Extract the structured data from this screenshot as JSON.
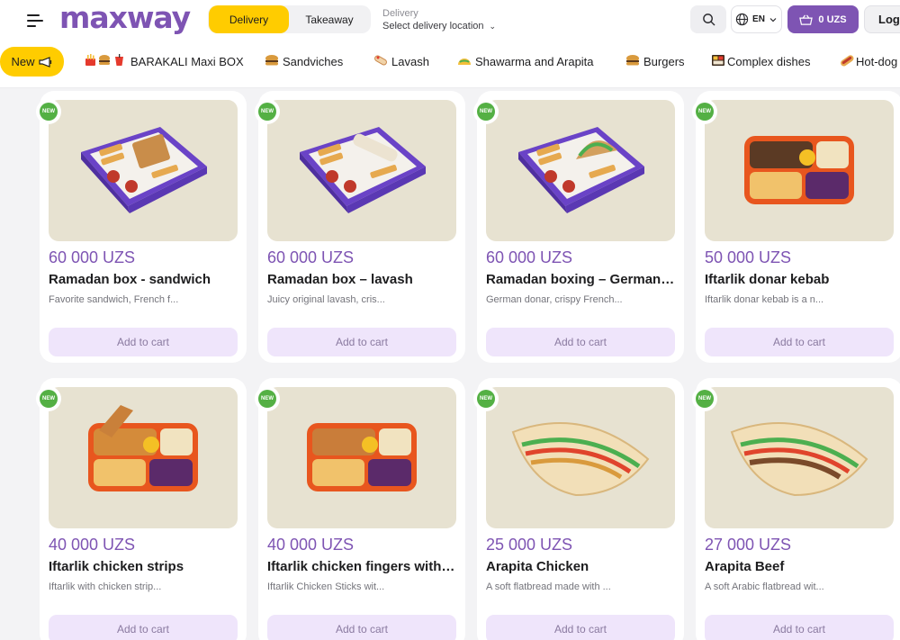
{
  "header": {
    "logo": "maxway",
    "mode": {
      "delivery": "Delivery",
      "takeaway": "Takeaway",
      "selected": "Delivery"
    },
    "location": {
      "label": "Delivery",
      "value": "Select delivery location"
    },
    "language": "EN",
    "cart_total": "0 UZS",
    "login": "Log"
  },
  "categories": [
    {
      "label": "New",
      "icon": "megaphone-icon",
      "active": true
    },
    {
      "label": "BARAKALI Maxi BOX",
      "icon": "fries-burger-cup-icon"
    },
    {
      "label": "Sandviches",
      "icon": "burger-icon"
    },
    {
      "label": "Lavash",
      "icon": "lavash-icon"
    },
    {
      "label": "Shawarma and Arapita",
      "icon": "taco-icon"
    },
    {
      "label": "Burgers",
      "icon": "burger-icon"
    },
    {
      "label": "Complex dishes",
      "icon": "bento-box-icon"
    },
    {
      "label": "Hot-dog",
      "icon": "hotdog-icon"
    }
  ],
  "badge_text": "NEW",
  "add_to_cart_label": "Add to cart",
  "products": [
    {
      "price": "60 000 UZS",
      "name": "Ramadan box - sandwich",
      "desc": "Favorite sandwich, French f...",
      "image": "purple-box-sandwich"
    },
    {
      "price": "60 000 UZS",
      "name": "Ramadan box – lavash",
      "desc": "Juicy original lavash, cris...",
      "image": "purple-box-lavash"
    },
    {
      "price": "60 000 UZS",
      "name": "Ramadan boxing – German donar",
      "desc": "German donar, crispy French...",
      "image": "purple-box-donar"
    },
    {
      "price": "50 000 UZS",
      "name": "Iftarlik donar kebab",
      "desc": "Iftarlik donar kebab is a n...",
      "image": "orange-tray-kebab"
    },
    {
      "price": "40 000 UZS",
      "name": "Iftarlik chicken strips",
      "desc": "Iftarlik with chicken strip...",
      "image": "orange-tray-strips"
    },
    {
      "price": "40 000 UZS",
      "name": "Iftarlik chicken fingers with fries",
      "desc": "Iftarlik Chicken Sticks wit...",
      "image": "orange-tray-fingers"
    },
    {
      "price": "25 000 UZS",
      "name": "Arapita Chicken",
      "desc": "A soft flatbread made with ...",
      "image": "arapita-chicken"
    },
    {
      "price": "27 000 UZS",
      "name": "Arapita Beef",
      "desc": "A soft Arabic flatbread wit...",
      "image": "arapita-beef"
    }
  ],
  "colors": {
    "brand_purple": "#7e54b3",
    "accent_yellow": "#ffcc00",
    "badge_green": "#54b044",
    "button_lilac": "#efe5fb"
  }
}
